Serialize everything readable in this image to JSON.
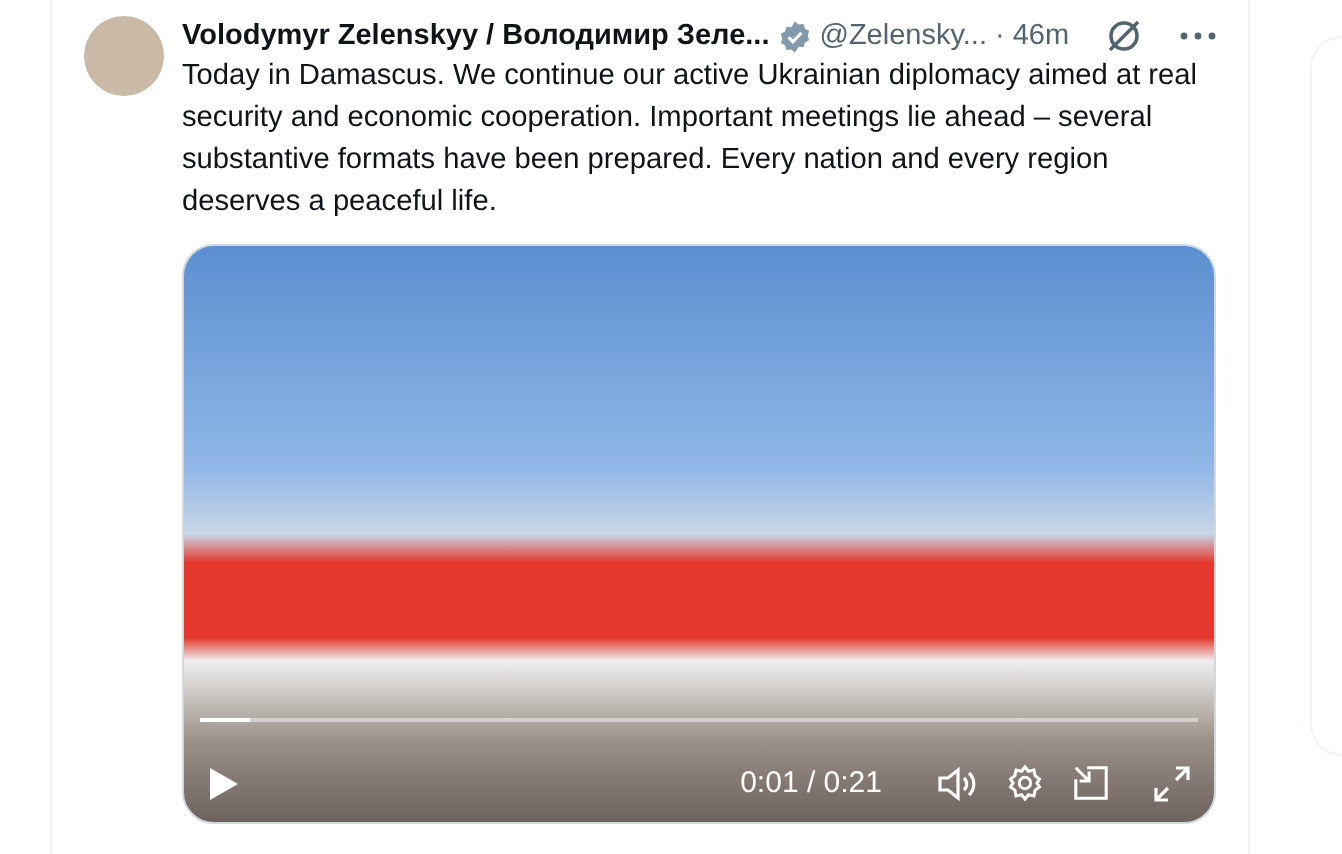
{
  "post": {
    "author_name": "Volodymyr Zelenskyy / Володимир Зеле...",
    "handle": "@Zelensky...",
    "separator": "·",
    "time": "46m",
    "text": "Today in Damascus. We continue our active Ukrainian diplomacy aimed at real security and economic cooperation. Important meetings lie ahead – several substantive formats have been prepared. Every nation and every region deserves a peaceful life.",
    "video": {
      "time": "0:01 / 0:21",
      "level": 0.05
    }
  }
}
